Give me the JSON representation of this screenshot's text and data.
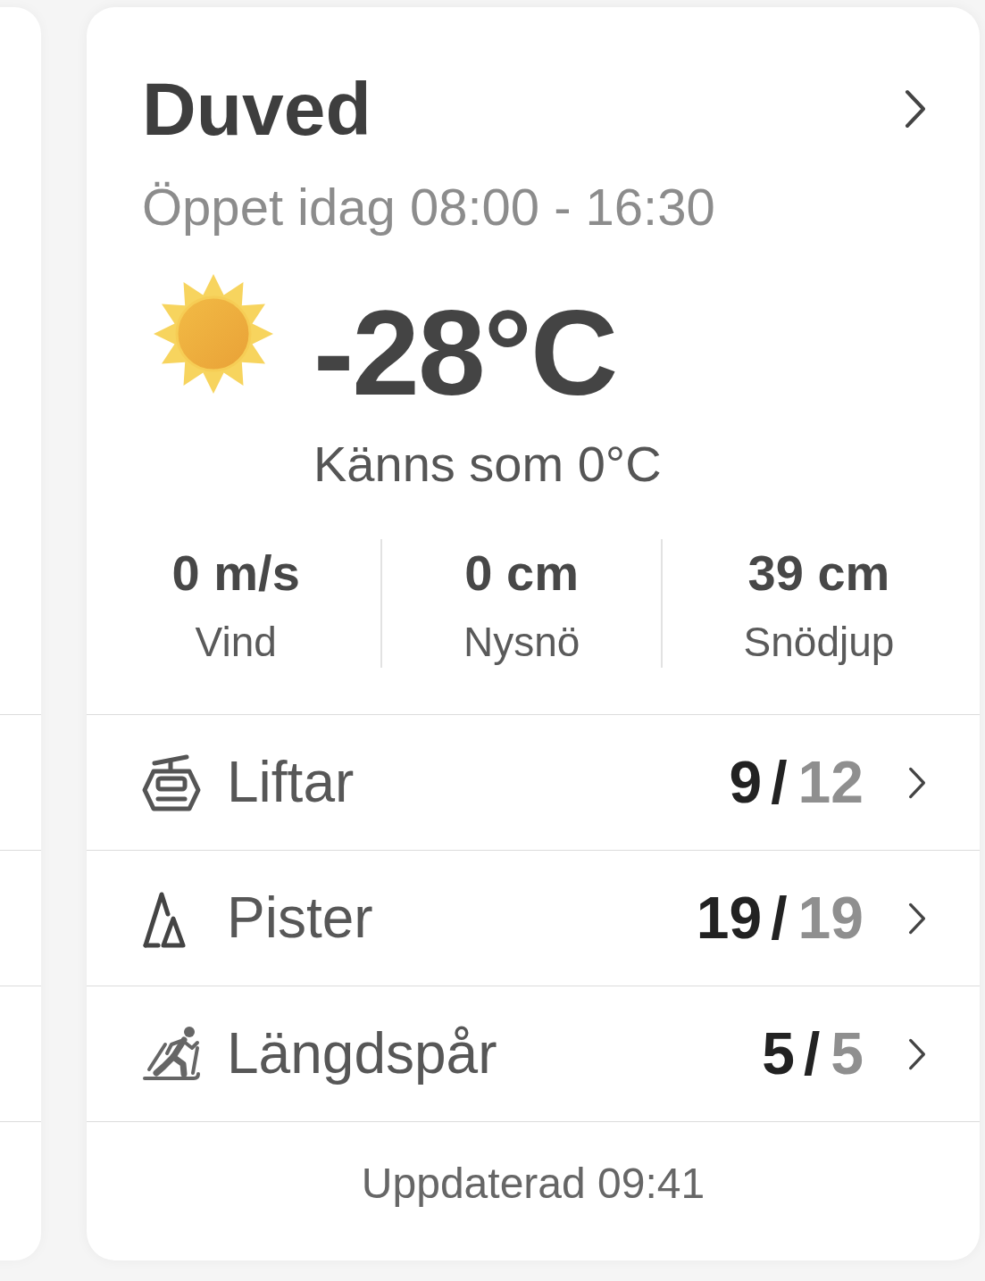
{
  "resort": {
    "name": "Duved",
    "hours": "Öppet idag 08:00 - 16:30"
  },
  "weather": {
    "temperature": "-28°C",
    "feels_like": "Känns som 0°C"
  },
  "stats": [
    {
      "value": "0 m/s",
      "label": "Vind"
    },
    {
      "value": "0 cm",
      "label": "Nysnö"
    },
    {
      "value": "39 cm",
      "label": "Snödjup"
    }
  ],
  "facilities": [
    {
      "kind": "lift",
      "label": "Liftar",
      "open": "9",
      "separator": "/",
      "total": "12"
    },
    {
      "kind": "slope",
      "label": "Pister",
      "open": "19",
      "separator": "/",
      "total": "19"
    },
    {
      "kind": "cross-country",
      "label": "Längdspår",
      "open": "5",
      "separator": "/",
      "total": "5"
    }
  ],
  "updated": "Uppdaterad 09:41"
}
